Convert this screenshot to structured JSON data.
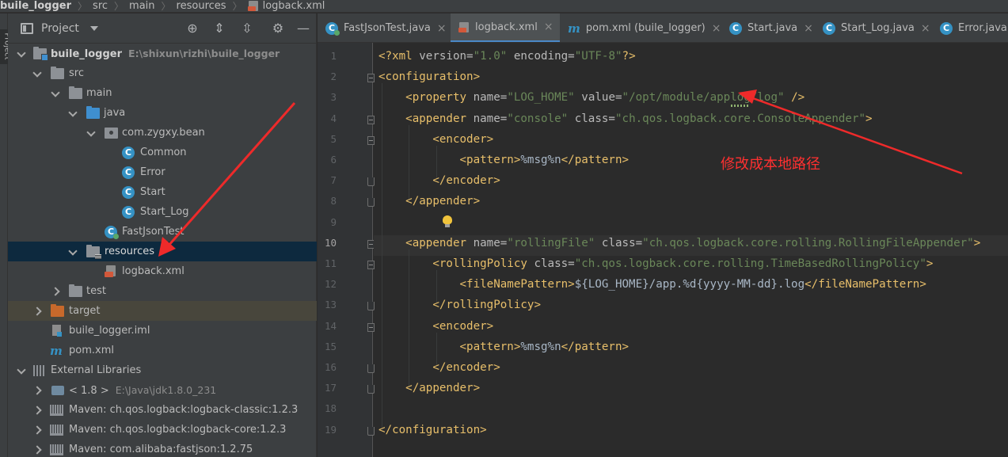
{
  "breadcrumb": [
    {
      "label": "buile_logger"
    },
    {
      "label": "src"
    },
    {
      "label": "main"
    },
    {
      "label": "resources"
    },
    {
      "label": "logback.xml",
      "icon": "xml-file-icon"
    }
  ],
  "left_strip": {
    "label": "Project"
  },
  "project_panel": {
    "title": "Project",
    "tools": [
      "locate-icon",
      "expand-all-icon",
      "collapse-all-icon",
      "settings-icon",
      "hide-icon"
    ],
    "tree": [
      {
        "label": "buile_logger",
        "path": "E:\\shixun\\rizhi\\buile_logger",
        "icon": "module-folder-icon",
        "arrow": "down",
        "bold": true
      },
      {
        "label": "src",
        "icon": "folder-icon",
        "arrow": "down"
      },
      {
        "label": "main",
        "icon": "folder-icon",
        "arrow": "down"
      },
      {
        "label": "java",
        "icon": "source-folder-icon",
        "arrow": "down"
      },
      {
        "label": "com.zygxy.bean",
        "icon": "package-icon",
        "arrow": "down"
      },
      {
        "label": "Common",
        "icon": "class-icon"
      },
      {
        "label": "Error",
        "icon": "class-icon"
      },
      {
        "label": "Start",
        "icon": "class-icon"
      },
      {
        "label": "Start_Log",
        "icon": "class-icon"
      },
      {
        "label": "FastJsonTest",
        "icon": "test-class-icon"
      },
      {
        "label": "resources",
        "icon": "resources-folder-icon",
        "arrow": "down",
        "selected": true
      },
      {
        "label": "logback.xml",
        "icon": "xml-file-icon"
      },
      {
        "label": "test",
        "icon": "folder-icon",
        "arrow": "right"
      },
      {
        "label": "target",
        "icon": "excluded-folder-icon",
        "arrow": "right",
        "highlight": true
      },
      {
        "label": "buile_logger.iml",
        "icon": "iml-file-icon"
      },
      {
        "label": "pom.xml",
        "icon": "maven-icon"
      },
      {
        "label": "External Libraries",
        "icon": "library-icon",
        "arrow": "down"
      },
      {
        "label": "< 1.8 >",
        "path": "E:\\Java\\jdk1.8.0_231",
        "icon": "jdk-icon",
        "arrow": "right"
      },
      {
        "label": "Maven: ch.qos.logback:logback-classic:1.2.3",
        "icon": "jar-icon",
        "arrow": "right"
      },
      {
        "label": "Maven: ch.qos.logback:logback-core:1.2.3",
        "icon": "jar-icon",
        "arrow": "right"
      },
      {
        "label": "Maven: com.alibaba:fastjson:1.2.75",
        "icon": "jar-icon",
        "arrow": "right"
      }
    ]
  },
  "editor": {
    "tabs": [
      {
        "label": "FastJsonTest.java",
        "icon": "test-class-icon",
        "active": false
      },
      {
        "label": "logback.xml",
        "icon": "xml-file-icon",
        "active": true
      },
      {
        "label": "pom.xml (buile_logger)",
        "icon": "maven-icon",
        "active": false
      },
      {
        "label": "Start.java",
        "icon": "class-icon",
        "active": false
      },
      {
        "label": "Start_Log.java",
        "icon": "class-icon",
        "active": false
      },
      {
        "label": "Error.java",
        "icon": "class-icon",
        "active": false
      }
    ],
    "current_line": 10,
    "lines": [
      [
        [
          "decl",
          "<?xml "
        ],
        [
          "attr",
          "version="
        ],
        [
          "val",
          "\"1.0\""
        ],
        [
          "attr",
          " encoding="
        ],
        [
          "val",
          "\"UTF-8\""
        ],
        [
          "decl",
          "?>"
        ]
      ],
      [
        [
          "tag",
          "<configuration>"
        ]
      ],
      [
        [
          "tag",
          "<property "
        ],
        [
          "attr",
          "name="
        ],
        [
          "val",
          "\"LOG_HOME\""
        ],
        [
          "attr",
          " value="
        ],
        [
          "val",
          "\"/opt/module/applog/log\""
        ],
        [
          "tag",
          " />"
        ]
      ],
      [
        [
          "tag",
          "<appender "
        ],
        [
          "attr",
          "name="
        ],
        [
          "val",
          "\"console\""
        ],
        [
          "attr",
          " class="
        ],
        [
          "val",
          "\"ch.qos.logback.core.ConsoleAppender\""
        ],
        [
          "tag",
          ">"
        ]
      ],
      [
        [
          "tag",
          "<encoder>"
        ]
      ],
      [
        [
          "tag",
          "<pattern>"
        ],
        [
          "txt",
          "%msg%n"
        ],
        [
          "tag",
          "</pattern>"
        ]
      ],
      [
        [
          "tag",
          "</encoder>"
        ]
      ],
      [
        [
          "tag",
          "</appender>"
        ]
      ],
      [],
      [
        [
          "tag",
          "<appender "
        ],
        [
          "attr",
          "name="
        ],
        [
          "val",
          "\"rollingFile\""
        ],
        [
          "attr",
          " class="
        ],
        [
          "val",
          "\"ch.qos.logback.core.rolling.RollingFileAppender\""
        ],
        [
          "tag",
          ">"
        ]
      ],
      [
        [
          "tag",
          "<rollingPolicy "
        ],
        [
          "attr",
          "class="
        ],
        [
          "val",
          "\"ch.qos.logback.core.rolling.TimeBasedRollingPolicy\""
        ],
        [
          "tag",
          ">"
        ]
      ],
      [
        [
          "tag",
          "<fileNamePattern>"
        ],
        [
          "txt",
          "${LOG_HOME}/app.%d{yyyy-MM-dd}.log"
        ],
        [
          "tag",
          "</fileNamePattern>"
        ]
      ],
      [
        [
          "tag",
          "</rollingPolicy>"
        ]
      ],
      [
        [
          "tag",
          "<encoder>"
        ]
      ],
      [
        [
          "tag",
          "<pattern>"
        ],
        [
          "txt",
          "%msg%n"
        ],
        [
          "tag",
          "</pattern>"
        ]
      ],
      [
        [
          "tag",
          "</encoder>"
        ]
      ],
      [
        [
          "tag",
          "</appender>"
        ]
      ],
      [],
      [
        [
          "tag",
          "</configuration>"
        ]
      ]
    ],
    "line_numbers": [
      "1",
      "2",
      "3",
      "4",
      "5",
      "6",
      "7",
      "8",
      "9",
      "10",
      "11",
      "12",
      "13",
      "14",
      "15",
      "16",
      "17",
      "18",
      "19"
    ]
  },
  "annotation": {
    "text": "修改成本地路径",
    "color": "#ff3030"
  },
  "colors": {
    "tag": "#e8bf6a",
    "attr": "#bababa",
    "value": "#6a8759",
    "text": "#a9b7c6",
    "selection": "#0d293e",
    "accent": "#4a88c7"
  }
}
